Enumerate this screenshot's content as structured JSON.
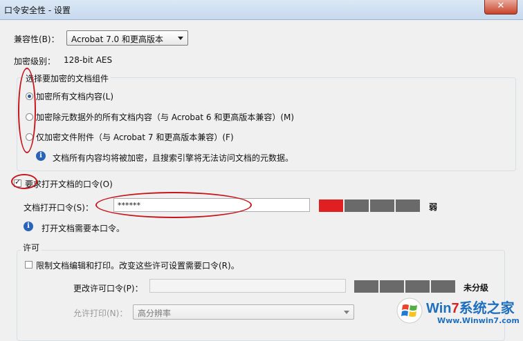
{
  "window": {
    "title": "口令安全性 - 设置",
    "close_glyph": "✕"
  },
  "compat": {
    "label": "兼容性(B)：",
    "value": "Acrobat 7.0 和更高版本"
  },
  "encryption": {
    "label": "加密级别：",
    "value": "128-bit AES"
  },
  "components": {
    "group_title": "选择要加密的文档组件",
    "options": [
      {
        "label": "加密所有文档内容(L)",
        "checked": true
      },
      {
        "label": "加密除元数据外的所有文档内容（与 Acrobat 6 和更高版本兼容）(M)",
        "checked": false
      },
      {
        "label": "仅加密文件附件（与 Acrobat 7 和更高版本兼容）(F)",
        "checked": false
      }
    ],
    "info": "文档所有内容均将被加密，且搜索引擎将无法访问文档的元数据。"
  },
  "open_password": {
    "require_label": "要求打开文档的口令(O)",
    "require_checked": true,
    "field_label": "文档打开口令(S)：",
    "value": "******",
    "strength_text": "弱",
    "strength_level": 0.25,
    "info": "打开文档需要本口令。"
  },
  "permissions": {
    "group_title": "许可",
    "restrict_label": "限制文档编辑和打印。改变这些许可设置需要口令(R)。",
    "restrict_checked": false,
    "change_pw_label": "更改许可口令(P)：",
    "change_pw_value": "",
    "strength_text": "未分级",
    "print_label": "允许打印(N)：",
    "print_value": "高分辨率"
  },
  "watermark": {
    "brand_win": "Win",
    "brand_7": "7",
    "brand_cn": "系统之家",
    "url": "Www.Winwin7.com"
  },
  "colors": {
    "annotation_red": "#c6161c",
    "strength_weak": "#e02020",
    "strength_empty": "#6a6a6a"
  }
}
